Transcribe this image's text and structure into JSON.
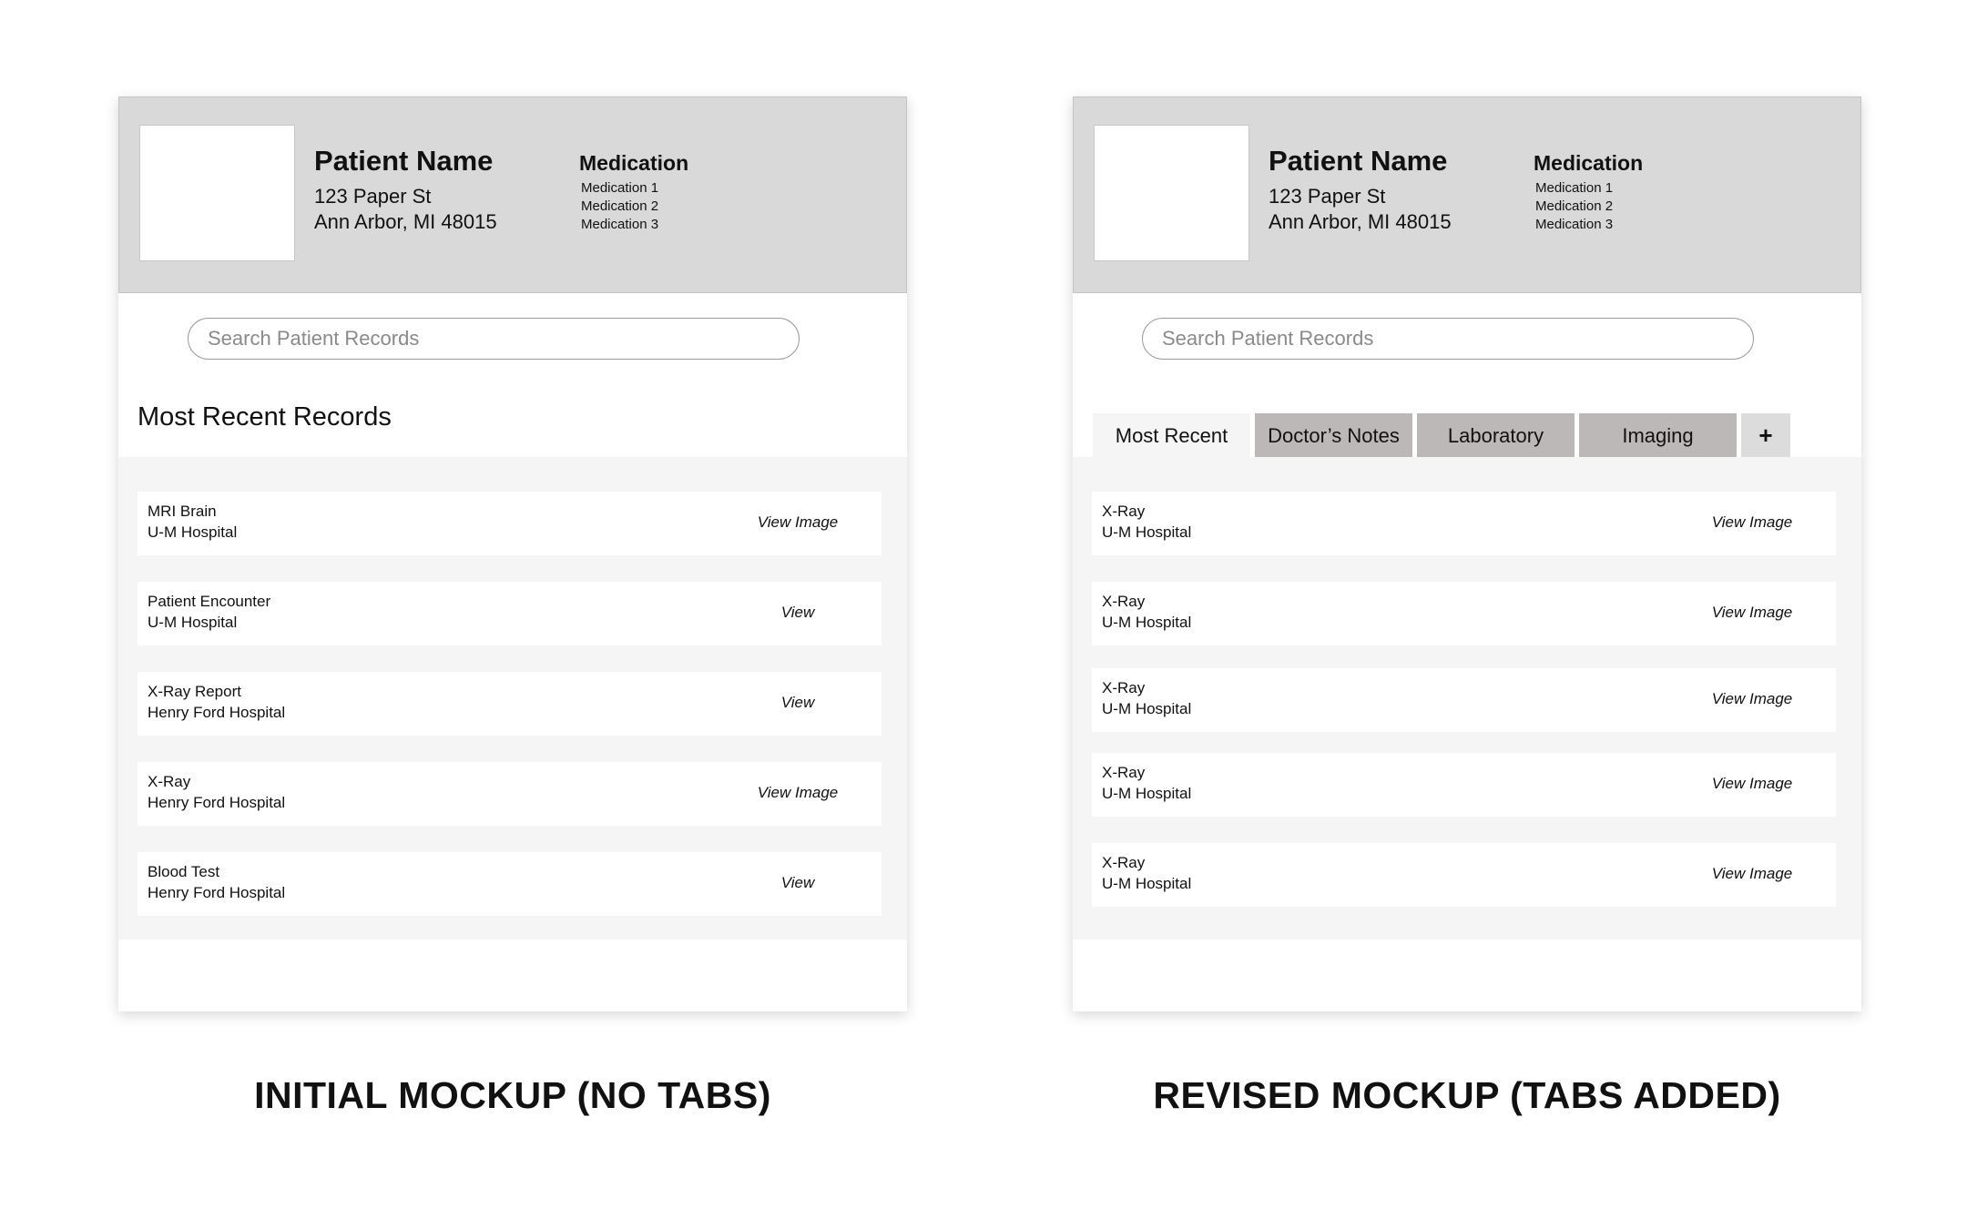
{
  "initial": {
    "patient_name": "Patient Name",
    "address_line1": "123 Paper St",
    "address_line2": "Ann Arbor, MI 48015",
    "medication_title": "Medication",
    "medications": [
      "Medication 1",
      "Medication 2",
      "Medication 3"
    ],
    "search_placeholder": "Search Patient Records",
    "section_title": "Most Recent Records",
    "records": [
      {
        "title": "MRI Brain",
        "location": "U-M Hospital",
        "action": "View Image"
      },
      {
        "title": "Patient Encounter",
        "location": "U-M Hospital",
        "action": "View"
      },
      {
        "title": "X-Ray Report",
        "location": "Henry Ford Hospital",
        "action": "View"
      },
      {
        "title": "X-Ray",
        "location": "Henry Ford Hospital",
        "action": "View Image"
      },
      {
        "title": "Blood Test",
        "location": "Henry Ford Hospital",
        "action": "View"
      }
    ],
    "caption": "INITIAL MOCKUP (NO TABS)"
  },
  "revised": {
    "patient_name": "Patient Name",
    "address_line1": "123 Paper St",
    "address_line2": "Ann Arbor, MI 48015",
    "medication_title": "Medication",
    "medications": [
      "Medication 1",
      "Medication 2",
      "Medication 3"
    ],
    "search_placeholder": "Search Patient Records",
    "tabs": [
      {
        "label": "Most Recent",
        "active": true
      },
      {
        "label": "Doctor’s Notes",
        "active": false
      },
      {
        "label": "Laboratory",
        "active": false
      },
      {
        "label": "Imaging",
        "active": false
      },
      {
        "label": "+",
        "active": false
      }
    ],
    "records": [
      {
        "title": "X-Ray",
        "location": "U-M Hospital",
        "action": "View Image"
      },
      {
        "title": "X-Ray",
        "location": "U-M Hospital",
        "action": "View Image"
      },
      {
        "title": "X-Ray",
        "location": "U-M Hospital",
        "action": "View Image"
      },
      {
        "title": "X-Ray",
        "location": "U-M Hospital",
        "action": "View Image"
      },
      {
        "title": "X-Ray",
        "location": "U-M Hospital",
        "action": "View Image"
      }
    ],
    "caption": "REVISED MOCKUP (TABS ADDED)"
  }
}
